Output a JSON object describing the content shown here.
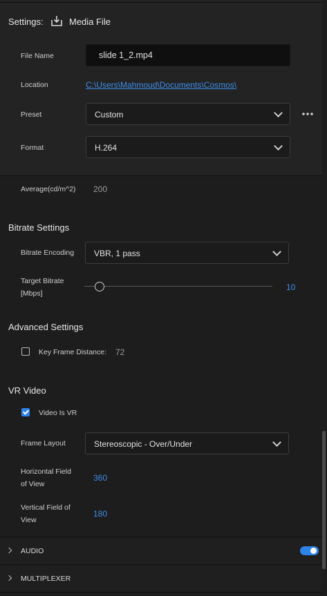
{
  "header": {
    "settings_label": "Settings:",
    "media_file_label": "Media File"
  },
  "fields": {
    "file_name": {
      "label": "File Name",
      "value": "slide 1_2.mp4"
    },
    "location": {
      "label": "Location",
      "value": "C:\\Users\\Mahmoud\\Documents\\Cosmos\\"
    },
    "preset": {
      "label": "Preset",
      "value": "Custom"
    },
    "format": {
      "label": "Format",
      "value": "H.264"
    },
    "average": {
      "label": "Average(cd/m^2)",
      "value": "200"
    }
  },
  "bitrate": {
    "title": "Bitrate Settings",
    "encoding_label": "Bitrate Encoding",
    "encoding_value": "VBR, 1 pass",
    "target_label_1": "Target Bitrate",
    "target_label_2": "[Mbps]",
    "target_value": "10",
    "slider_fraction": 0.0
  },
  "advanced": {
    "title": "Advanced Settings",
    "keyframe_label": "Key Frame Distance:",
    "keyframe_value": "72",
    "keyframe_checked": false
  },
  "vr": {
    "title": "VR Video",
    "is_vr_label": "Video Is VR",
    "is_vr_checked": true,
    "frame_layout_label": "Frame Layout",
    "frame_layout_value": "Stereoscopic - Over/Under",
    "hfov_label_1": "Horizontal Field",
    "hfov_label_2": "of View",
    "hfov_value": "360",
    "vfov_label_1": "Vertical Field of",
    "vfov_label_2": "View",
    "vfov_value": "180"
  },
  "collapsed": {
    "audio": "AUDIO",
    "multiplexer": "MULTIPLEXER",
    "audio_enabled": true
  },
  "colors": {
    "accent": "#2d83e8",
    "link": "#3d8eea",
    "background": "#1d1d1d"
  }
}
